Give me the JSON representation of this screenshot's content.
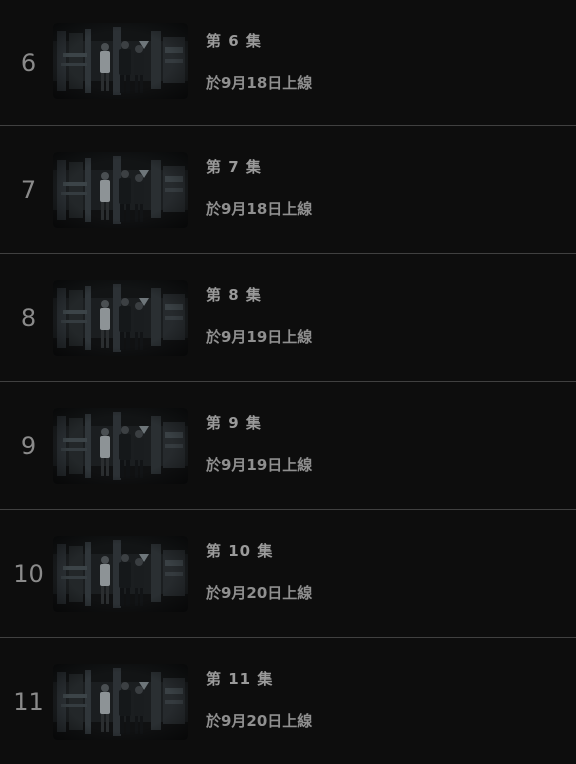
{
  "episodes": [
    {
      "number": "6",
      "title": "第 6 集",
      "release": "於9月18日上線"
    },
    {
      "number": "7",
      "title": "第 7 集",
      "release": "於9月18日上線"
    },
    {
      "number": "8",
      "title": "第 8 集",
      "release": "於9月19日上線"
    },
    {
      "number": "9",
      "title": "第 9 集",
      "release": "於9月19日上線"
    },
    {
      "number": "10",
      "title": "第 10 集",
      "release": "於9月20日上線"
    },
    {
      "number": "11",
      "title": "第 11 集",
      "release": "於9月20日上線"
    }
  ],
  "thumbnail_icon": "episode-still-thumbnail",
  "colors": {
    "background": "#0d0d0d",
    "divider": "#404040",
    "text_muted": "#8a8a8a"
  }
}
